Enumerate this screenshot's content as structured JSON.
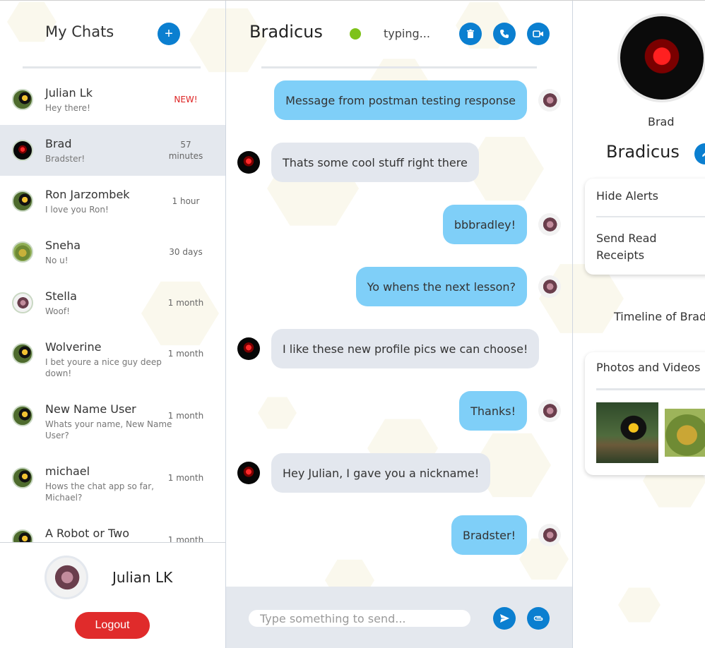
{
  "sidebar": {
    "title": "My Chats",
    "chats": [
      {
        "name": "Julian Lk",
        "preview": "Hey there!",
        "time": "NEW!"
      },
      {
        "name": "Brad",
        "preview": "Bradster!",
        "time": "57 minutes"
      },
      {
        "name": "Ron Jarzombek",
        "preview": "I love you Ron!",
        "time": "1 hour"
      },
      {
        "name": "Sneha",
        "preview": "No u!",
        "time": "30 days"
      },
      {
        "name": "Stella",
        "preview": "Woof!",
        "time": "1 month"
      },
      {
        "name": "Wolverine",
        "preview": "I bet youre a nice guy deep down!",
        "time": "1 month"
      },
      {
        "name": "New Name User",
        "preview": "Whats your name, New Name User?",
        "time": "1 month"
      },
      {
        "name": "michael",
        "preview": "Hows the chat app so far, Michael?",
        "time": "1 month"
      },
      {
        "name": "A Robot or Two",
        "preview": "",
        "time": "1 month"
      }
    ],
    "user_name": "Julian LK",
    "logout_label": "Logout"
  },
  "chat": {
    "title": "Bradicus",
    "status": "typing...",
    "messages": [
      {
        "text": "Message from postman testing response",
        "direction": "out"
      },
      {
        "text": "Thats some cool stuff right there",
        "direction": "in"
      },
      {
        "text": "bbbradley!",
        "direction": "out"
      },
      {
        "text": "Yo whens the next lesson?",
        "direction": "out"
      },
      {
        "text": "I like these new profile pics we can choose!",
        "direction": "in"
      },
      {
        "text": "Thanks!",
        "direction": "out"
      },
      {
        "text": "Hey Julian, I gave you a nickname!",
        "direction": "in"
      },
      {
        "text": "Bradster!",
        "direction": "out"
      }
    ],
    "input_placeholder": "Type something to send..."
  },
  "profile": {
    "username": "Brad",
    "nickname": "Bradicus",
    "settings": [
      "Hide Alerts",
      "Send Read Receipts"
    ],
    "timeline_label": "Timeline of Brad",
    "media_title": "Photos and Videos"
  },
  "colors": {
    "accent": "#0b7fd0",
    "outgoing_bubble": "#7fcff8",
    "incoming_bubble": "#e3e7ee",
    "online": "#7ec21a",
    "logout": "#e02b2b",
    "new_badge": "#dd2222"
  },
  "icons": [
    "plus-icon",
    "trash-icon",
    "phone-icon",
    "video-icon",
    "send-icon",
    "attach-icon",
    "pencil-icon"
  ]
}
